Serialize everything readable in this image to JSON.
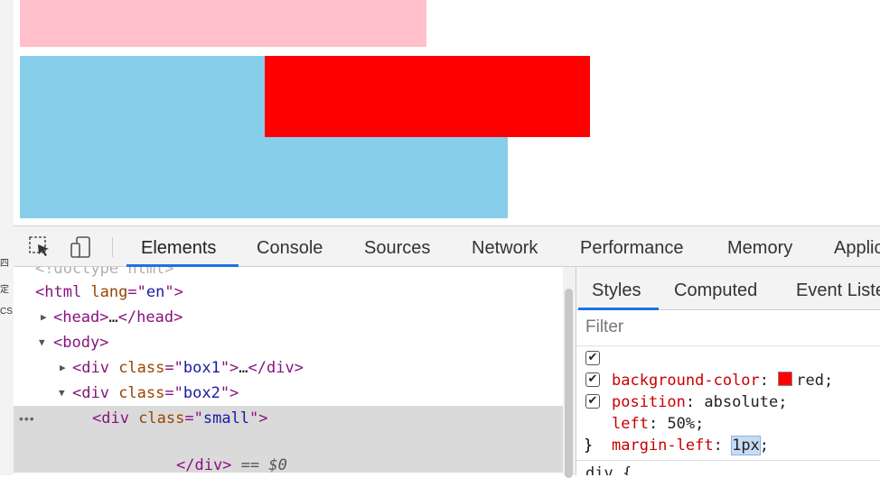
{
  "page": {
    "bg": "#ffffff"
  },
  "left_strip": {
    "chars": [
      "四",
      "定",
      "CS"
    ]
  },
  "viewport": {
    "boxes": [
      {
        "name": "pink-box",
        "color": "#ffc0cb"
      },
      {
        "name": "box2",
        "color": "#87ceeb"
      },
      {
        "name": "small-box",
        "color": "#ff0000"
      }
    ]
  },
  "toolbar": {
    "icons": [
      "inspect-element-icon",
      "device-toggle-icon"
    ],
    "tabs": [
      {
        "label": "Elements",
        "active": true
      },
      {
        "label": "Console"
      },
      {
        "label": "Sources"
      },
      {
        "label": "Network"
      },
      {
        "label": "Performance"
      },
      {
        "label": "Memory"
      },
      {
        "label": "Applic"
      }
    ]
  },
  "elements": {
    "dots": "•••",
    "lines": {
      "doctype": "<!doctype html>",
      "html_open": {
        "tag_open": "<html ",
        "attr": "lang",
        "eq": "=\"",
        "value": "en",
        "close": "\">"
      },
      "head": {
        "tag_open": "<head>",
        "ellipsis": "…",
        "tag_close": "</head>"
      },
      "body": {
        "tag_open": "<body>"
      },
      "box1": {
        "tag_open": "<div ",
        "attr": "class",
        "eq": "=\"",
        "value": "box1",
        "close": "\">",
        "ellipsis": "…",
        "tag_close": "</div>"
      },
      "box2": {
        "tag_open": "<div ",
        "attr": "class",
        "eq": "=\"",
        "value": "box2",
        "close": "\">"
      },
      "small": {
        "tag_open": "<div ",
        "attr": "class",
        "eq": "=\"",
        "value": "small",
        "close": "\">"
      },
      "small_close": {
        "tag_close": "</div>",
        "marker": " == $0"
      }
    }
  },
  "styles": {
    "tabs": [
      {
        "label": "Styles",
        "active": true
      },
      {
        "label": "Computed"
      },
      {
        "label": "Event Liste"
      }
    ],
    "filter_placeholder": "Filter",
    "props": [
      {
        "name": "background-color",
        "value": "red",
        "checked": true,
        "swatch": "#ff0000"
      },
      {
        "name": "position",
        "value": "absolute",
        "checked": true
      },
      {
        "name": "left",
        "value": "50%",
        "checked": true
      },
      {
        "name": "margin-left",
        "value": "1px",
        "checked": false,
        "editing": true
      }
    ],
    "rule_close": "}",
    "next_rule": "div {",
    "colon": ": ",
    "semicolon": ";"
  }
}
